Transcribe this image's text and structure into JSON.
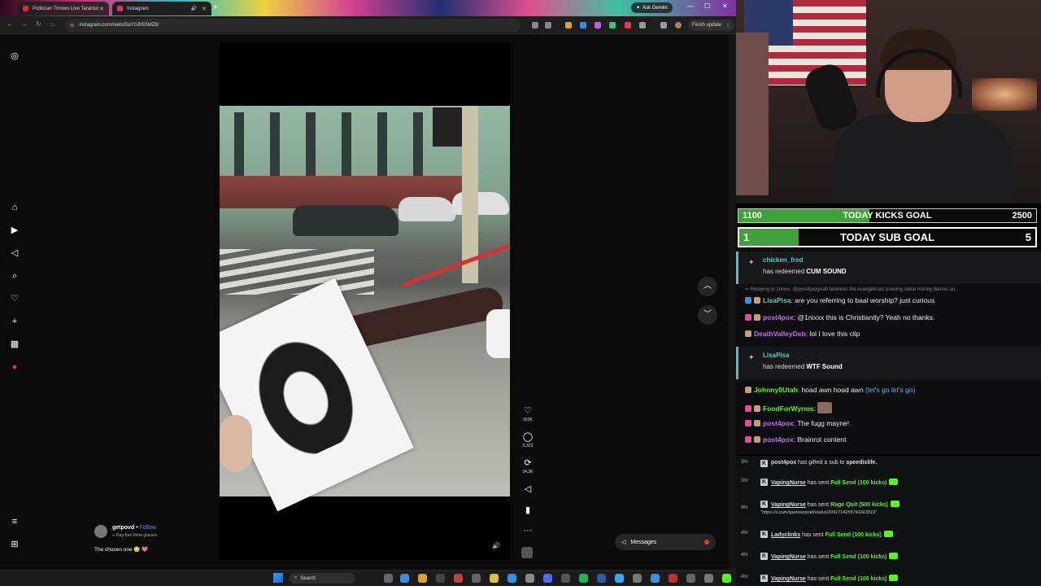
{
  "browser": {
    "tabs": [
      {
        "label": "Politician Throws Live Tarantul",
        "favicon_color": "#d03030"
      },
      {
        "label": "Instagram",
        "favicon_color": "#e1306c"
      }
    ],
    "gemini_label": "Ask Gemini",
    "url": "instagram.com/reels/DaY0Jh5SMZ8/",
    "finish_update_label": "Finish update"
  },
  "instagram": {
    "sidebar_icons": [
      "instagram-logo-icon",
      "home-icon",
      "reels-icon",
      "explore-icon",
      "search-icon",
      "notifications-icon",
      "create-icon",
      "dashboard-icon",
      "profile-icon",
      "menu-icon",
      "also-from-meta-icon"
    ],
    "actions": {
      "likes": "903K",
      "comments": "5,323",
      "reposts": "34.3K"
    },
    "author": {
      "username": "getpovd",
      "follow_label": "Follow",
      "glasses_label": "Ray-Ban Meta glasses",
      "caption": "The chosen one 😳 💖"
    },
    "messages_label": "Messages"
  },
  "taskbar": {
    "search_placeholder": "Search",
    "apps": [
      "file-explorer",
      "edge",
      "chrome",
      "obs",
      "folder",
      "store",
      "spotify",
      "discord",
      "steam",
      "photoshop",
      "mail",
      "settings"
    ]
  },
  "stream": {
    "kicks_goal": {
      "current": "1100",
      "label": "TODAY KICKS GOAL",
      "target": "2500",
      "progress": 0.44
    },
    "sub_goal": {
      "current": "1",
      "label": "TODAY SUB GOAL",
      "target": "5",
      "progress": 0.2
    },
    "accent_color": "#53fc18",
    "chat": {
      "redeem1": {
        "user": "chicken_fred",
        "text_prefix": "has redeemed ",
        "reward": "CUM SOUND"
      },
      "reply_context": "Replying to 1nixxx: @post4poxyeah between the evangelicals praising some money demon an...",
      "messages": [
        {
          "user": "LisaPisa",
          "color": "#4fd3c3",
          "text": "are you referring to baal worship? just curious"
        },
        {
          "user": "post4pox",
          "color": "#c86af0",
          "text": "@1nixxx this is Christianity? Yeah no thanks."
        },
        {
          "user": "DeathValleyDeb",
          "color": "#c86af0",
          "text": "lol I love this clip"
        }
      ],
      "redeem2": {
        "user": "LisaPisa",
        "text_prefix": "has redeemed ",
        "reward": "WTF Sound"
      },
      "messages2": [
        {
          "user": "Johnny0Utah",
          "color": "#53fc18",
          "text": "hoad awn hoad awn",
          "link": "(let's go let's go)"
        },
        {
          "user": "FoodForWyrms",
          "color": "#53fc18",
          "text": ""
        },
        {
          "user": "post4pox",
          "color": "#c86af0",
          "text": "The fugg mayne!"
        },
        {
          "user": "post4pox",
          "color": "#c86af0",
          "text": "Brainrot content"
        }
      ]
    },
    "feed": [
      {
        "time": "3hr",
        "user": "post4pox",
        "action": "has gifted a sub to",
        "target": "speedislife.",
        "reward": ""
      },
      {
        "time": "3hr",
        "user": "VapingNurse",
        "action": "has sent",
        "target": "",
        "reward": "Full Send (100 kicks)"
      },
      {
        "time": "4hr",
        "user": "VapingNurse",
        "action": "has sent",
        "target": "",
        "reward": "Rage Quit (500 kicks)",
        "url": "\"https://x.com/spencerpratt/status/2091714255741663019\""
      },
      {
        "time": "4hr",
        "user": "Ladyclinks",
        "action": "has sent",
        "target": "",
        "reward": "Full Send (100 kicks)"
      },
      {
        "time": "4hr",
        "user": "VapingNurse",
        "action": "has sent",
        "target": "",
        "reward": "Full Send (100 kicks)"
      },
      {
        "time": "4hr",
        "user": "VapingNurse",
        "action": "has sent",
        "target": "",
        "reward": "Full Send (100 kicks)"
      }
    ]
  }
}
